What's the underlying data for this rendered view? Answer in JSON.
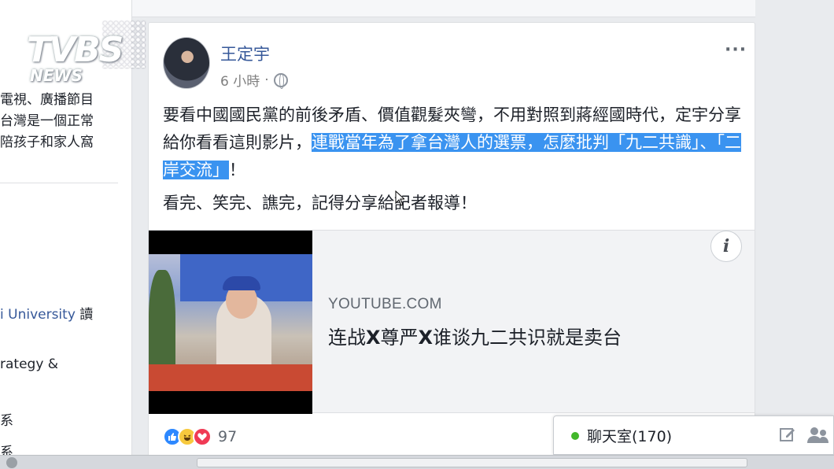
{
  "watermark": {
    "brand": "TVBS",
    "sub": "NEWS"
  },
  "left_column": {
    "lines": [
      "電視、廣播節目",
      "台灣是一個正常",
      "陪孩子和家人窩"
    ],
    "university": "i University",
    "university_suffix": "讀",
    "strategy": "rategy &",
    "char1": "系",
    "char2": "系"
  },
  "post": {
    "author": "王定宇",
    "time": "6 小時",
    "time_sep": "·",
    "more": "···",
    "text_plain": "要看中國國民黨的前後矛盾、價值觀髮夾彎，不用對照到蔣經國時代，定宇分享給你看看這則影片，",
    "text_highlight": "連戰當年為了拿台灣人的選票，怎麼批判「九二共識」、「二岸交流」",
    "text_end": "！",
    "text2": "看完、笑完、譙完，記得分享給記者報導！",
    "link": {
      "domain": "YOUTUBE.COM",
      "title_a": "连战",
      "title_x1": "X",
      "title_b": "尊严",
      "title_x2": "X",
      "title_c": "谁谈九二共识就是卖台",
      "info": "i"
    },
    "reactions": {
      "count": "97",
      "icons": [
        "like-icon",
        "haha-icon",
        "love-icon"
      ]
    }
  },
  "chat": {
    "label": "聊天室(170)",
    "status_color": "#42b72a"
  },
  "colors": {
    "link_blue": "#365899",
    "highlight": "#3a93f0",
    "background": "#e9ebee"
  }
}
